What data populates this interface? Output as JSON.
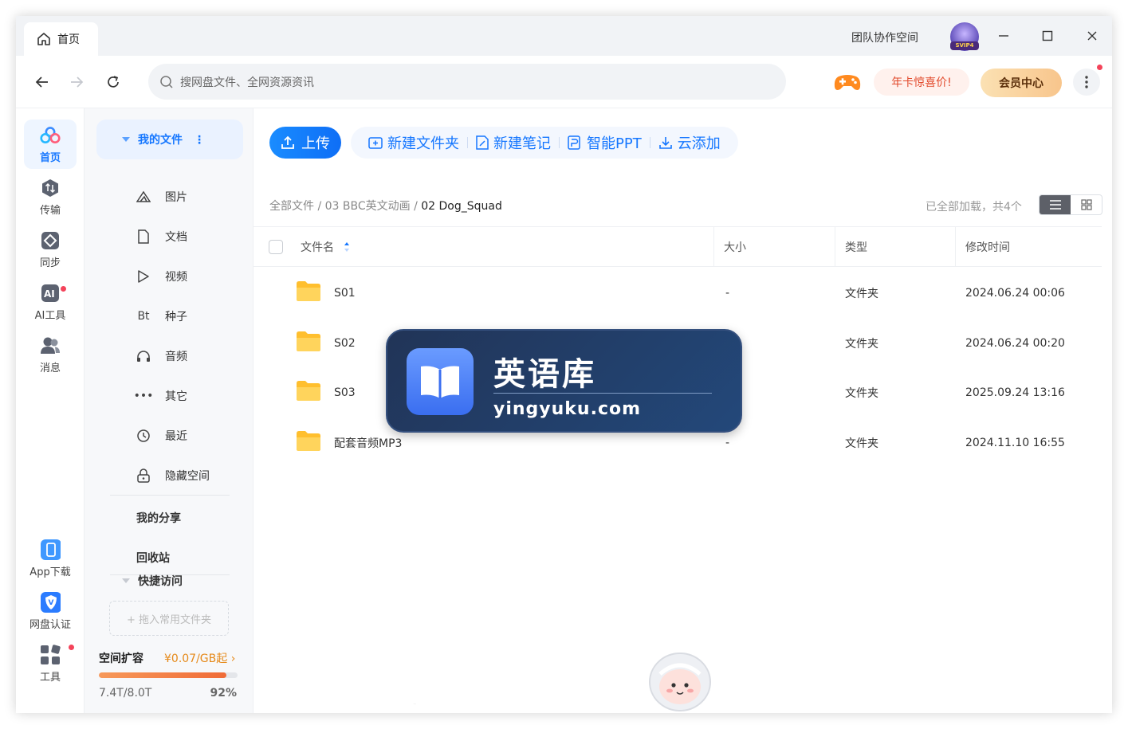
{
  "titlebar": {
    "home_tab": "首页",
    "team_space": "团队协作空间",
    "avatar_badge": "SVIP4"
  },
  "navbar": {
    "search_placeholder": "搜网盘文件、全网资源资讯",
    "promo": "年卡惊喜价!",
    "vip": "会员中心"
  },
  "rail": {
    "items": [
      {
        "label": "首页",
        "icon": "cloud-home-icon"
      },
      {
        "label": "传输",
        "icon": "transfer-icon"
      },
      {
        "label": "同步",
        "icon": "sync-icon"
      },
      {
        "label": "AI工具",
        "icon": "ai-tools-icon"
      },
      {
        "label": "消息",
        "icon": "messages-icon"
      }
    ],
    "bottom": [
      {
        "label": "App下载",
        "icon": "phone-icon"
      },
      {
        "label": "网盘认证",
        "icon": "shield-icon"
      },
      {
        "label": "工具",
        "icon": "grid-tools-icon"
      }
    ]
  },
  "sidebar": {
    "my_files": "我的文件",
    "categories": [
      {
        "label": "图片",
        "icon": "image-icon"
      },
      {
        "label": "文档",
        "icon": "document-icon"
      },
      {
        "label": "视频",
        "icon": "video-icon"
      },
      {
        "label": "种子",
        "icon": "torrent-icon",
        "glyph": "Bt"
      },
      {
        "label": "音频",
        "icon": "headphones-icon"
      },
      {
        "label": "其它",
        "icon": "more-dots-icon",
        "glyph": "•••"
      },
      {
        "label": "最近",
        "icon": "recent-icon"
      },
      {
        "label": "隐藏空间",
        "icon": "lock-icon"
      }
    ],
    "my_share": "我的分享",
    "recycle": "回收站",
    "quick_access": "快捷访问",
    "drop_hint": "+ 拖入常用文件夹",
    "space_expand": "空间扩容",
    "space_price": "¥0.07/GB起 ›",
    "usage_text": "7.4T/8.0T",
    "usage_percent": "92%",
    "usage_fraction": 0.92
  },
  "toolbar": {
    "upload": "上传",
    "new_folder": "新建文件夹",
    "new_note": "新建笔记",
    "smart_ppt": "智能PPT",
    "cloud_add": "云添加"
  },
  "breadcrumb": {
    "root": "全部文件",
    "sep": " / ",
    "level1": "03 BBC英文动画",
    "current": "02 Dog_Squad"
  },
  "status": {
    "loaded": "已全部加载，共4个"
  },
  "table": {
    "columns": [
      "文件名",
      "大小",
      "类型",
      "修改时间"
    ],
    "rows": [
      {
        "name": "S01",
        "size": "-",
        "type": "文件夹",
        "modified": "2024.06.24 00:06"
      },
      {
        "name": "S02",
        "size": "-",
        "type": "文件夹",
        "modified": "2024.06.24 00:20"
      },
      {
        "name": "S03",
        "size": "-",
        "type": "文件夹",
        "modified": "2025.09.24 13:16"
      },
      {
        "name": "配套音频MP3",
        "size": "-",
        "type": "文件夹",
        "modified": "2024.11.10 16:55"
      }
    ]
  },
  "watermark": {
    "title": "英语库",
    "url": "yingyuku.com"
  },
  "colors": {
    "accent": "#1677ff",
    "promo_red": "#e24a2c",
    "folder_yellow": "#ffc83d",
    "watermark_bg": "#223b62"
  }
}
